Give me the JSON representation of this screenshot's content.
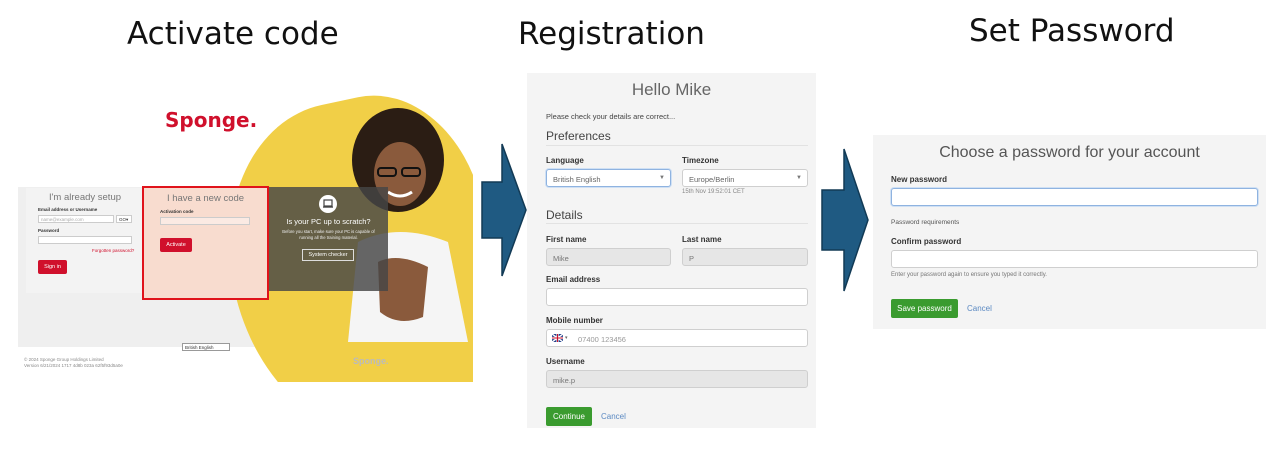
{
  "steps": {
    "activate": "Activate code",
    "registration": "Registration",
    "set_password": "Set Password"
  },
  "activate_panel": {
    "logo": "Sponge.",
    "existing": {
      "title": "I'm already setup",
      "email_label": "Email address or Username",
      "email_placeholder": "name@example.com",
      "email_suffix": "GO▾",
      "password_label": "Password",
      "forgot": "Forgotten password?",
      "signin": "Sign in"
    },
    "new_code": {
      "title": "I have a new code",
      "code_label": "Activation code",
      "activate": "Activate"
    },
    "scratch": {
      "title": "Is your PC up to scratch?",
      "body": "Before you start, make sure your PC is capable of running all the training material.",
      "button": "System checker"
    },
    "footer": {
      "language": "British English",
      "copyright": "© 2024 Sponge Group Holdings Limited",
      "version": "Version 6/21/2024 1717 4d8b 023a 62f5f93d5a0e",
      "logo": "Sponge."
    }
  },
  "registration": {
    "greeting": "Hello Mike",
    "intro": "Please check your details are correct...",
    "preferences": "Preferences",
    "language_label": "Language",
    "language_value": "British English",
    "timezone_label": "Timezone",
    "timezone_value": "Europe/Berlin",
    "timezone_time": "15th Nov 19:52:01 CET",
    "details": "Details",
    "first_name_label": "First name",
    "first_name_value": "Mike",
    "last_name_label": "Last name",
    "last_name_value": "P",
    "email_label": "Email address",
    "email_value": "",
    "mobile_label": "Mobile number",
    "mobile_value": "07400 123456",
    "mobile_flag": "🇬🇧",
    "username_label": "Username",
    "username_value": "mike.p",
    "continue": "Continue",
    "cancel": "Cancel"
  },
  "password": {
    "title": "Choose a password for your account",
    "new_label": "New password",
    "requirements": "Password requirements",
    "confirm_label": "Confirm password",
    "hint": "Enter your password again to ensure you typed it correctly.",
    "save": "Save password",
    "cancel": "Cancel"
  },
  "colors": {
    "brand_red": "#d0102c",
    "highlight_red": "#e0131b",
    "accent_yellow": "#f1cf47",
    "arrow_blue": "#1f5a82",
    "green": "#3a9b2f",
    "link": "#5b89c2"
  }
}
